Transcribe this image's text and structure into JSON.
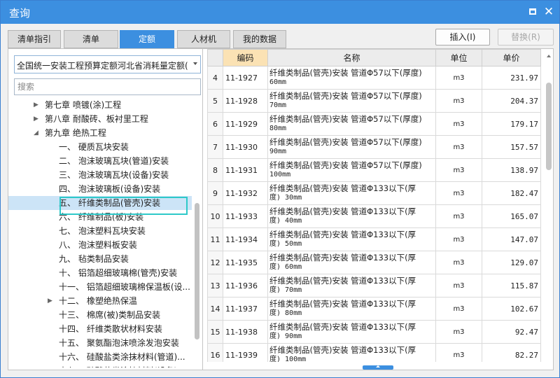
{
  "window": {
    "title": "查询"
  },
  "tabs": [
    {
      "label": "清单指引"
    },
    {
      "label": "清单"
    },
    {
      "label": "定额"
    },
    {
      "label": "人材机"
    },
    {
      "label": "我的数据"
    }
  ],
  "actions": {
    "insert": "插入(I)",
    "replace": "替换(R)"
  },
  "left": {
    "library": "全国统一安装工程预算定额河北省消耗量定额(",
    "search_placeholder": "搜索",
    "tree": [
      {
        "label": "第七章 喷镀(涂)工程",
        "indent": 1,
        "expander": "▶"
      },
      {
        "label": "第八章 耐酸砖、板衬里工程",
        "indent": 1,
        "expander": "▶"
      },
      {
        "label": "第九章 绝热工程",
        "indent": 1,
        "expander": "◢"
      },
      {
        "label": "一、 硬质瓦块安装",
        "indent": 2,
        "expander": ""
      },
      {
        "label": "二、 泡沫玻璃瓦块(管道)安装",
        "indent": 2,
        "expander": ""
      },
      {
        "label": "三、 泡沫玻璃瓦块(设备)安装",
        "indent": 2,
        "expander": ""
      },
      {
        "label": "四、 泡沫玻璃板(设备)安装",
        "indent": 2,
        "expander": ""
      },
      {
        "label": "五、 纤维类制品(管壳)安装",
        "indent": 2,
        "expander": "",
        "selected": true
      },
      {
        "label": "六、 纤维制品(板)安装",
        "indent": 2,
        "expander": ""
      },
      {
        "label": "七、 泡沫塑料瓦块安装",
        "indent": 2,
        "expander": ""
      },
      {
        "label": "八、 泡沫塑料板安装",
        "indent": 2,
        "expander": ""
      },
      {
        "label": "九、 毡类制品安装",
        "indent": 2,
        "expander": ""
      },
      {
        "label": "十、 铝箔超细玻璃棉(管壳)安装",
        "indent": 2,
        "expander": ""
      },
      {
        "label": "十一、 铝箔超细玻璃棉保温板(设...",
        "indent": 2,
        "expander": ""
      },
      {
        "label": "十二、 橡塑绝热保温",
        "indent": 2,
        "expander": "▶"
      },
      {
        "label": "十三、 棉席(被)类制品安装",
        "indent": 2,
        "expander": ""
      },
      {
        "label": "十四、 纤维类散状材料安装",
        "indent": 2,
        "expander": ""
      },
      {
        "label": "十五、 聚氨酯泡沫喷涂发泡安装",
        "indent": 2,
        "expander": ""
      },
      {
        "label": "十六、 硅酸盐类涂抹材料(管道)...",
        "indent": 2,
        "expander": ""
      },
      {
        "label": "十七、 硅酸盐类涂抹材料(设备)...",
        "indent": 2,
        "expander": ""
      }
    ]
  },
  "grid": {
    "columns": [
      {
        "label": ""
      },
      {
        "label": "编码"
      },
      {
        "label": "名称"
      },
      {
        "label": "单位"
      },
      {
        "label": "单价"
      }
    ],
    "rows": [
      {
        "no": "4",
        "code": "11-1927",
        "name1": "纤维类制品(管壳)安装 管道Φ57以下(厚度)",
        "name2": "60mm",
        "unit": "m3",
        "price": "231.97"
      },
      {
        "no": "5",
        "code": "11-1928",
        "name1": "纤维类制品(管壳)安装 管道Φ57以下(厚度)",
        "name2": "70mm",
        "unit": "m3",
        "price": "204.37"
      },
      {
        "no": "6",
        "code": "11-1929",
        "name1": "纤维类制品(管壳)安装 管道Φ57以下(厚度)",
        "name2": "80mm",
        "unit": "m3",
        "price": "179.17"
      },
      {
        "no": "7",
        "code": "11-1930",
        "name1": "纤维类制品(管壳)安装 管道Φ57以下(厚度)",
        "name2": "90mm",
        "unit": "m3",
        "price": "157.57"
      },
      {
        "no": "8",
        "code": "11-1931",
        "name1": "纤维类制品(管壳)安装 管道Φ57以下(厚度)",
        "name2": "100mm",
        "unit": "m3",
        "price": "138.97"
      },
      {
        "no": "9",
        "code": "11-1932",
        "name1": "纤维类制品(管壳)安装 管道Φ133以下(厚",
        "name2": "度) 30mm",
        "unit": "m3",
        "price": "182.47"
      },
      {
        "no": "10",
        "code": "11-1933",
        "name1": "纤维类制品(管壳)安装 管道Φ133以下(厚",
        "name2": "度) 40mm",
        "unit": "m3",
        "price": "165.07"
      },
      {
        "no": "11",
        "code": "11-1934",
        "name1": "纤维类制品(管壳)安装 管道Φ133以下(厚",
        "name2": "度) 50mm",
        "unit": "m3",
        "price": "147.07"
      },
      {
        "no": "12",
        "code": "11-1935",
        "name1": "纤维类制品(管壳)安装 管道Φ133以下(厚",
        "name2": "度) 60mm",
        "unit": "m3",
        "price": "129.07"
      },
      {
        "no": "13",
        "code": "11-1936",
        "name1": "纤维类制品(管壳)安装 管道Φ133以下(厚",
        "name2": "度) 70mm",
        "unit": "m3",
        "price": "115.87"
      },
      {
        "no": "14",
        "code": "11-1937",
        "name1": "纤维类制品(管壳)安装 管道Φ133以下(厚",
        "name2": "度) 80mm",
        "unit": "m3",
        "price": "102.67"
      },
      {
        "no": "15",
        "code": "11-1938",
        "name1": "纤维类制品(管壳)安装 管道Φ133以下(厚",
        "name2": "度) 90mm",
        "unit": "m3",
        "price": "92.47"
      },
      {
        "no": "16",
        "code": "11-1939",
        "name1": "纤维类制品(管壳)安装 管道Φ133以下(厚",
        "name2": "度) 100mm",
        "unit": "m3",
        "price": "82.27"
      }
    ]
  },
  "icons": {
    "maximize": "maximize-icon",
    "close": "close-icon",
    "dropdown": "chevron-down-icon"
  },
  "colors": {
    "accent": "#3c8fe0",
    "focus": "#2ec9c9",
    "active_header": "#fbe2b4",
    "selection": "#cce4f7"
  }
}
